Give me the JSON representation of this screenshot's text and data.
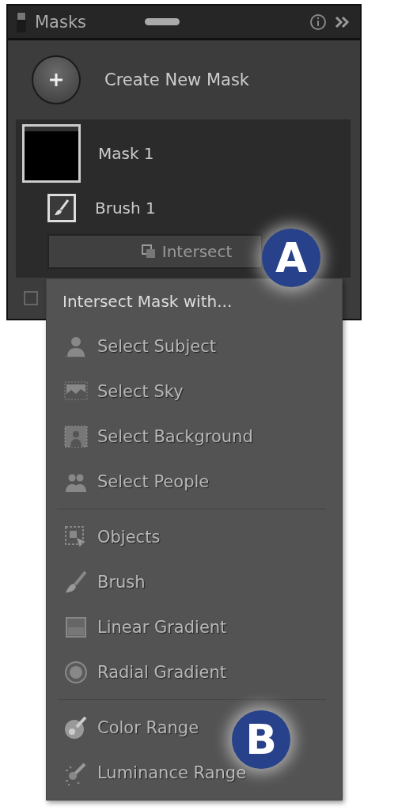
{
  "panel": {
    "title": "Masks"
  },
  "create_button": {
    "label": "Create New Mask"
  },
  "masks": [
    {
      "name": "Mask 1",
      "kind": "mask",
      "children": [
        {
          "name": "Brush 1",
          "kind": "brush"
        }
      ]
    }
  ],
  "intersect_button": {
    "label": "Intersect"
  },
  "footer_checkbox": {
    "checked": false
  },
  "menu": {
    "heading": "Intersect Mask with...",
    "sections": [
      [
        {
          "label": "Select Subject",
          "kind": "subject"
        },
        {
          "label": "Select Sky",
          "kind": "sky"
        },
        {
          "label": "Select Background",
          "kind": "background"
        },
        {
          "label": "Select People",
          "kind": "people"
        }
      ],
      [
        {
          "label": "Objects",
          "kind": "objects"
        },
        {
          "label": "Brush",
          "kind": "brush"
        },
        {
          "label": "Linear Gradient",
          "kind": "linear"
        },
        {
          "label": "Radial Gradient",
          "kind": "radial"
        }
      ],
      [
        {
          "label": "Color Range",
          "kind": "color"
        },
        {
          "label": "Luminance Range",
          "kind": "luminance"
        }
      ]
    ]
  },
  "callouts": [
    {
      "label": "A"
    },
    {
      "label": "B"
    }
  ]
}
